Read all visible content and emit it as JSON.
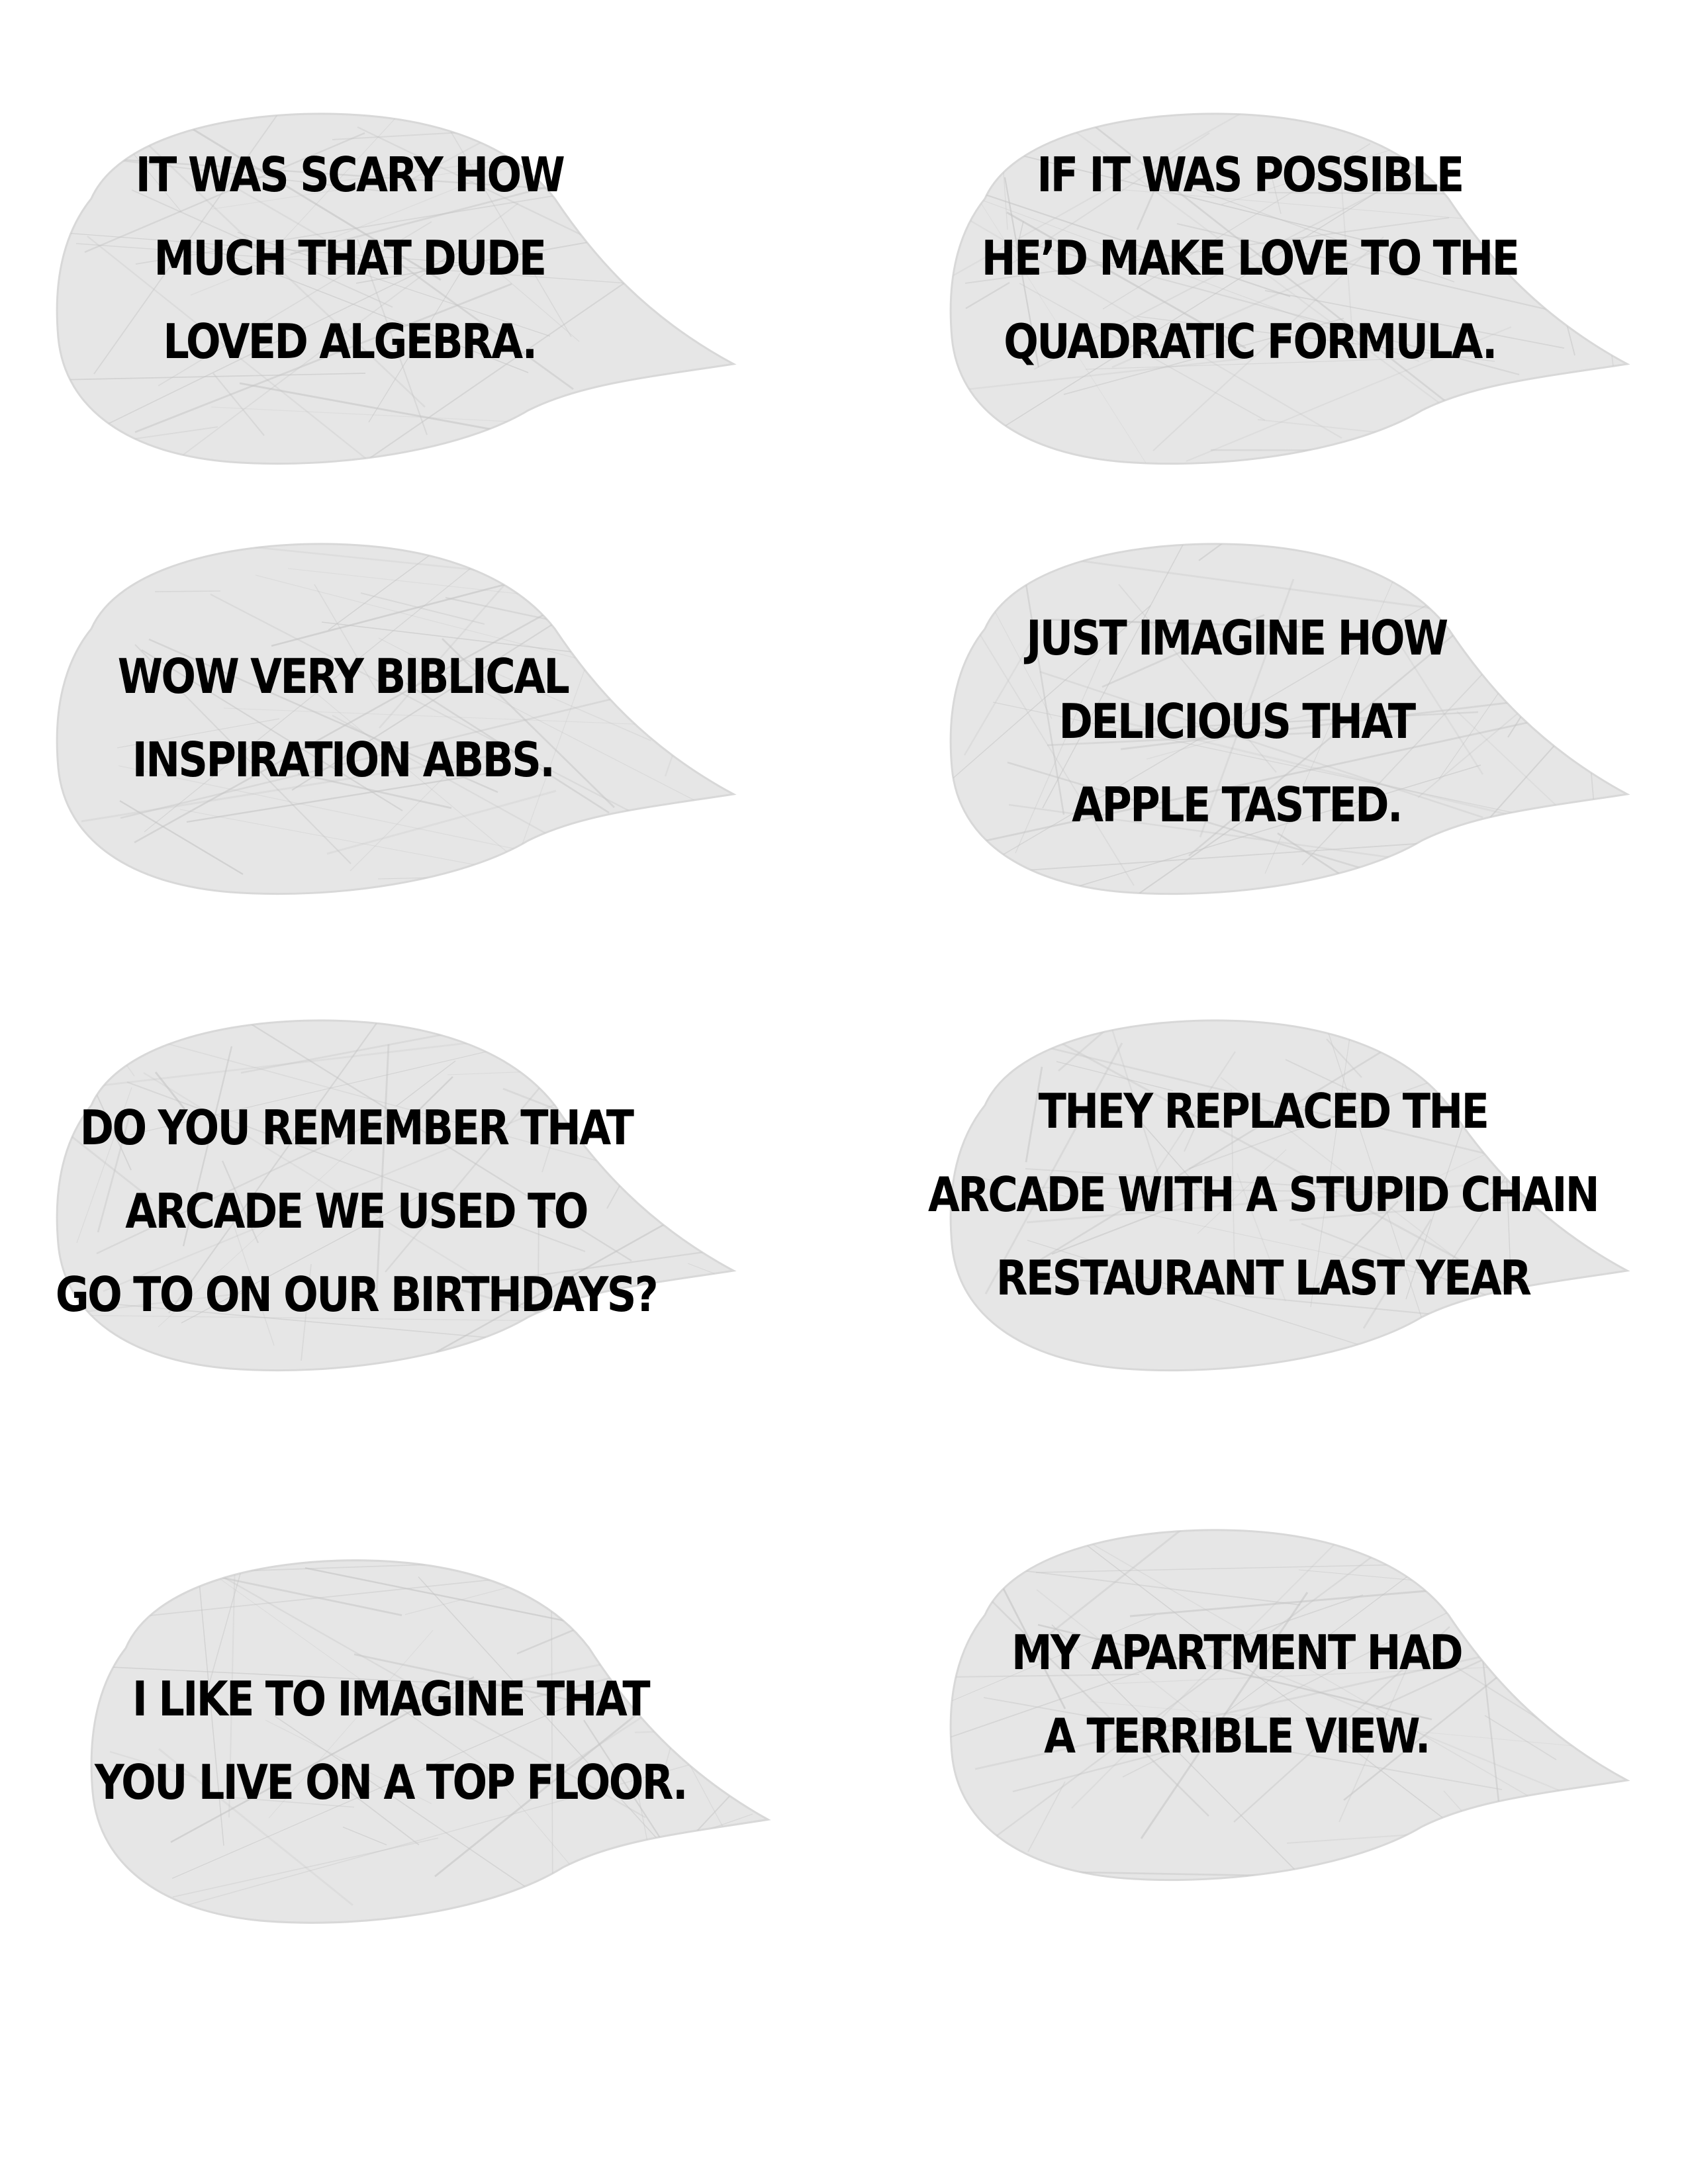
{
  "page": {
    "background_color": "#ffffff",
    "paper_color": "#e6e6e6",
    "paper_crease_color": "#c4c4c4",
    "text_color": "#000000"
  },
  "bubbles": [
    {
      "lines": [
        "IT WAS SCARY HOW",
        "MUCH THAT DUDE",
        "LOVED ALGEBRA."
      ]
    },
    {
      "lines": [
        "IF IT WAS POSSIBLE",
        "HE’D MAKE LOVE TO THE",
        "QUADRATIC FORMULA."
      ]
    },
    {
      "lines": [
        "WOW VERY BIBLICAL",
        "INSPIRATION ABBS."
      ]
    },
    {
      "lines": [
        "JUST IMAGINE HOW",
        "DELICIOUS THAT",
        "APPLE TASTED."
      ]
    },
    {
      "lines": [
        "DO YOU REMEMBER THAT",
        "ARCADE WE USED TO",
        "GO TO ON OUR BIRTHDAYS?"
      ]
    },
    {
      "lines": [
        "THEY REPLACED THE",
        "ARCADE WITH A STUPID CHAIN",
        "RESTAURANT LAST YEAR"
      ]
    },
    {
      "lines": [
        "I LIKE TO IMAGINE THAT",
        "YOU LIVE ON A TOP FLOOR."
      ]
    },
    {
      "lines": [
        "MY APARTMENT HAD",
        "A TERRIBLE VIEW."
      ]
    }
  ]
}
